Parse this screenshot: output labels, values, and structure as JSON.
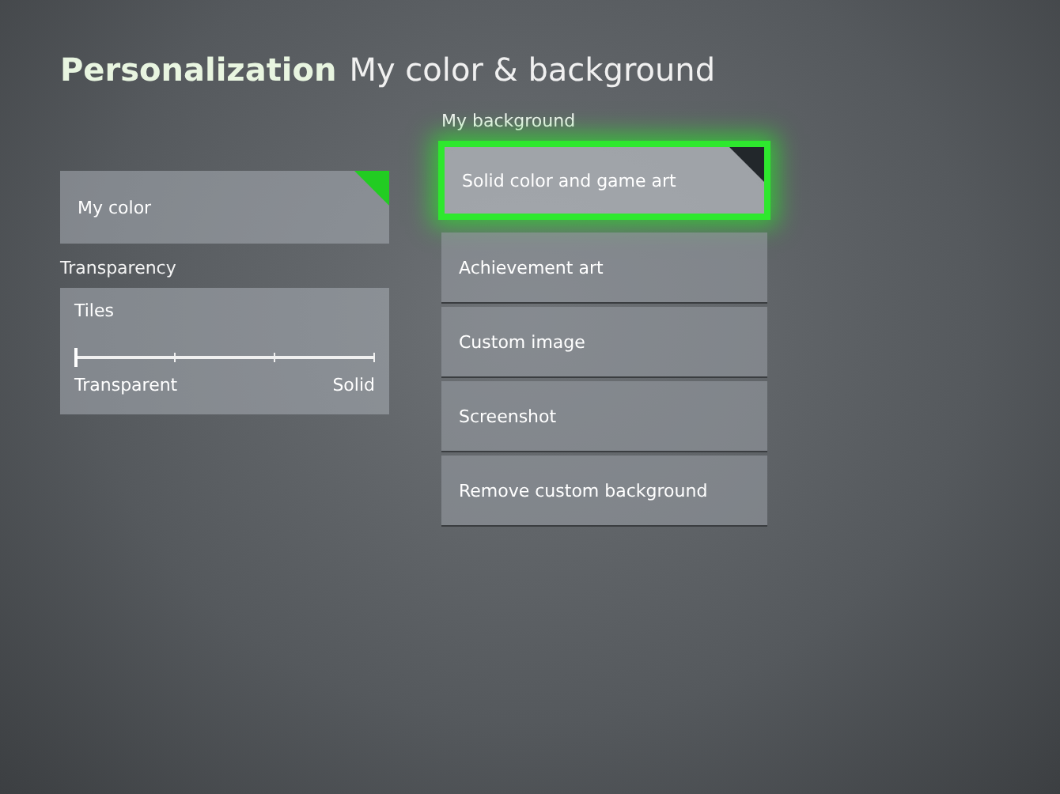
{
  "header": {
    "section": "Personalization",
    "page": "My color & background"
  },
  "my_color": {
    "label": "My color",
    "color": "#22cc22"
  },
  "transparency": {
    "heading": "Transparency",
    "tile_label": "Tiles",
    "level": 0,
    "min_label": "Transparent",
    "max_label": "Solid"
  },
  "background": {
    "heading": "My background",
    "options": [
      {
        "label": "Solid color and game art",
        "selected": true,
        "focused": true
      },
      {
        "label": "Achievement art",
        "selected": false,
        "focused": false
      },
      {
        "label": "Custom image",
        "selected": false,
        "focused": false
      },
      {
        "label": "Screenshot",
        "selected": false,
        "focused": false
      },
      {
        "label": "Remove custom background",
        "selected": false,
        "focused": false
      }
    ]
  }
}
